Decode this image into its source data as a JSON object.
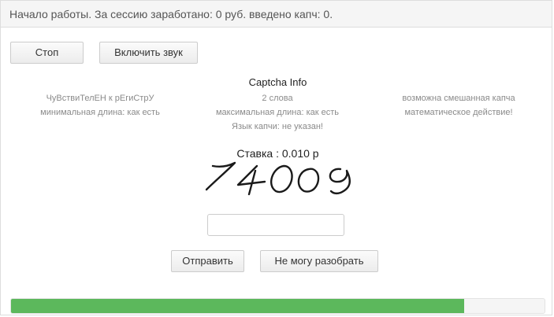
{
  "status": {
    "text": "Начало работы. За сессию заработано: 0 руб. введено капч: 0."
  },
  "controls": {
    "stop_label": "Стоп",
    "sound_label": "Включить звук"
  },
  "captcha_info": {
    "title": "Captcha Info",
    "left": [
      "ЧуВствиТелЕН к рЕгиСтрУ",
      "минимальная длина: как есть"
    ],
    "middle": [
      "2 слова",
      "максимальная длина: как есть",
      "Язык капчи: не указан!"
    ],
    "right": [
      "возможна смешанная капча",
      "математическое действие!"
    ]
  },
  "bid": {
    "text": "Ставка : 0.010 р"
  },
  "captcha": {
    "image_text": "74009",
    "input_value": "",
    "input_placeholder": ""
  },
  "actions": {
    "submit_label": "Отправить",
    "cant_label": "Не могу разобрать"
  },
  "progress": {
    "fraction": 0.85,
    "color": "#5cb85c"
  }
}
